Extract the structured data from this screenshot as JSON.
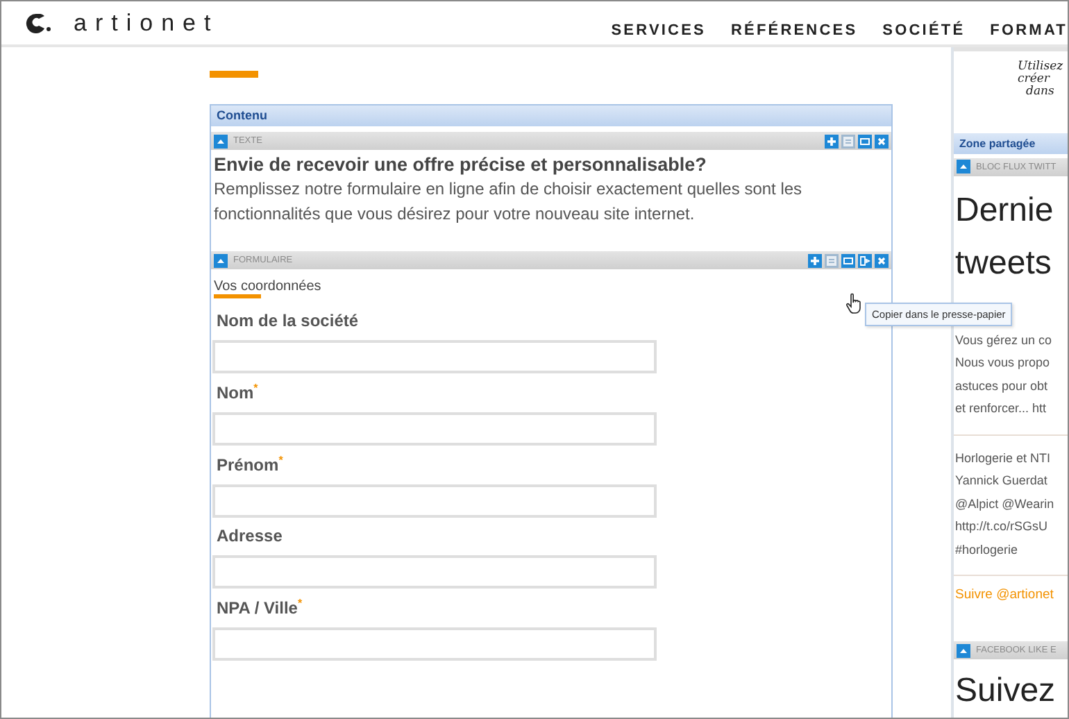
{
  "header": {
    "logo": "artionet",
    "nav": [
      {
        "label": "SERVICES"
      },
      {
        "label": "RÉFÉRENCES"
      },
      {
        "label": "SOCIÉTÉ"
      },
      {
        "label": "FORMAT"
      }
    ]
  },
  "content": {
    "title": "Contenu",
    "blocks": [
      {
        "kind": "text",
        "label": "TEXTE",
        "heading": "Envie de recevoir une offre précise et personnalisable?",
        "body": "Remplissez notre formulaire en ligne afin de choisir exactement quelles sont les fonctionnalités que vous désirez pour votre nouveau site internet."
      },
      {
        "kind": "form",
        "label": "FORMULAIRE",
        "section": "Vos coordonnées",
        "fields": [
          {
            "label": "Nom de la société"
          },
          {
            "label": "Nom$^{*}$"
          },
          {
            "label": "Prénom$^{*}$"
          },
          {
            "label": "Adresse"
          },
          {
            "label": "NPA / Ville$^{*}$"
          }
        ]
      }
    ]
  },
  "tooltip": "Copier dans le presse-papier",
  "sidebar": {
    "note": [
      "Utilisez",
      "créer",
      "dans"
    ],
    "title": "Zone partagée",
    "blocks": [
      {
        "kind": "twitter",
        "label": "BLOC FLUX TWITT",
        "heading": [
          "Dernie",
          "tweets"
        ],
        "tweets": [
          [
            "Vous gérez un co",
            "Nous vous propo",
            "astuces pour obt",
            "et renforcer... htt"
          ],
          [
            "Horlogerie et NTI",
            "Yannick Guerdat",
            "@Alpict @Wearin",
            "http://t.co/rSGsU",
            "#horlogerie"
          ]
        ],
        "follow": "Suivre @artionet"
      },
      {
        "kind": "facebook",
        "label": "FACEBOOK LIKE E",
        "heading": [
          "Suivez"
        ]
      }
    ]
  }
}
